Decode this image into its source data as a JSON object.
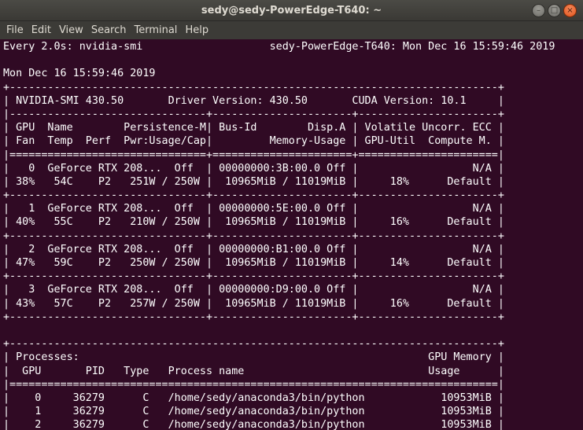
{
  "window": {
    "title": "sedy@sedy-PowerEdge-T640: ~",
    "controls": {
      "minimize_symbol": "–",
      "maximize_symbol": "□",
      "close_symbol": "×"
    }
  },
  "menubar": {
    "items": [
      "File",
      "Edit",
      "View",
      "Search",
      "Terminal",
      "Help"
    ]
  },
  "terminal": {
    "lines": [
      "Every 2.0s: nvidia-smi                    sedy-PowerEdge-T640: Mon Dec 16 15:59:46 2019",
      "",
      "Mon Dec 16 15:59:46 2019",
      "+-----------------------------------------------------------------------------+",
      "| NVIDIA-SMI 430.50       Driver Version: 430.50       CUDA Version: 10.1     |",
      "|-------------------------------+----------------------+----------------------+",
      "| GPU  Name        Persistence-M| Bus-Id        Disp.A | Volatile Uncorr. ECC |",
      "| Fan  Temp  Perf  Pwr:Usage/Cap|         Memory-Usage | GPU-Util  Compute M. |",
      "|===============================+======================+======================|",
      "|   0  GeForce RTX 208...  Off  | 00000000:3B:00.0 Off |                  N/A |",
      "| 38%   54C    P2   251W / 250W |  10965MiB / 11019MiB |     18%      Default |",
      "+-------------------------------+----------------------+----------------------+",
      "|   1  GeForce RTX 208...  Off  | 00000000:5E:00.0 Off |                  N/A |",
      "| 40%   55C    P2   210W / 250W |  10965MiB / 11019MiB |     16%      Default |",
      "+-------------------------------+----------------------+----------------------+",
      "|   2  GeForce RTX 208...  Off  | 00000000:B1:00.0 Off |                  N/A |",
      "| 47%   59C    P2   250W / 250W |  10965MiB / 11019MiB |     14%      Default |",
      "+-------------------------------+----------------------+----------------------+",
      "|   3  GeForce RTX 208...  Off  | 00000000:D9:00.0 Off |                  N/A |",
      "| 43%   57C    P2   257W / 250W |  10965MiB / 11019MiB |     16%      Default |",
      "+-------------------------------+----------------------+----------------------+",
      "",
      "+-----------------------------------------------------------------------------+",
      "| Processes:                                                       GPU Memory |",
      "|  GPU       PID   Type   Process name                             Usage      |",
      "|=============================================================================|",
      "|    0     36279      C   /home/sedy/anaconda3/bin/python            10953MiB |",
      "|    1     36279      C   /home/sedy/anaconda3/bin/python            10953MiB |",
      "|    2     36279      C   /home/sedy/anaconda3/bin/python            10953MiB |"
    ]
  },
  "colors": {
    "terminal_background": "#300a24",
    "terminal_text": "#ffffff",
    "titlebar": "#3c3b37",
    "title_text": "#dfdbd2",
    "close_button": "#e95420"
  }
}
